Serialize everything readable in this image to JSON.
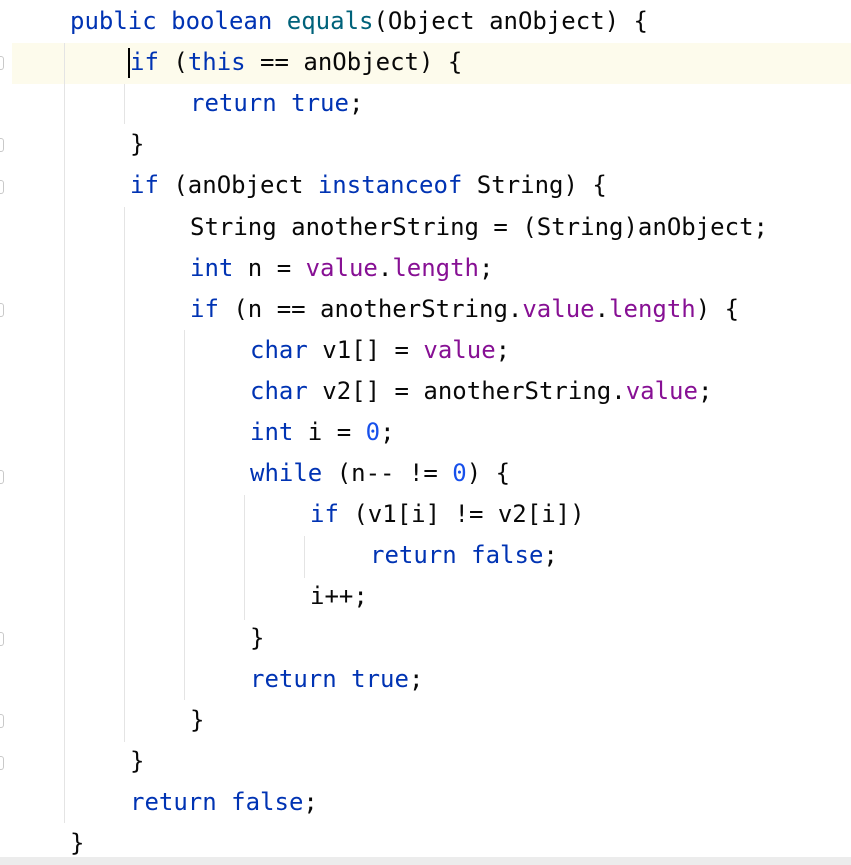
{
  "editor": {
    "language": "Java",
    "colors": {
      "keyword": "#0033b3",
      "method": "#00627a",
      "field": "#871094",
      "number": "#1750eb",
      "text": "#080808",
      "caret_line_bg": "#fdfbec"
    },
    "lines": [
      [
        {
          "t": "public",
          "c": "kw"
        },
        {
          "t": " "
        },
        {
          "t": "boolean",
          "c": "kw"
        },
        {
          "t": " "
        },
        {
          "t": "equals",
          "c": "fn"
        },
        {
          "t": "(Object anObject) {"
        }
      ],
      [
        {
          "t": "if",
          "c": "kw"
        },
        {
          "t": " ("
        },
        {
          "t": "this",
          "c": "kw"
        },
        {
          "t": " == anObject) {"
        }
      ],
      [
        {
          "t": "return",
          "c": "kw"
        },
        {
          "t": " "
        },
        {
          "t": "true",
          "c": "kw"
        },
        {
          "t": ";"
        }
      ],
      [
        {
          "t": "}"
        }
      ],
      [
        {
          "t": "if",
          "c": "kw"
        },
        {
          "t": " (anObject "
        },
        {
          "t": "instanceof",
          "c": "kw"
        },
        {
          "t": " String) {"
        }
      ],
      [
        {
          "t": "String anotherString = (String)anObject;"
        }
      ],
      [
        {
          "t": "int",
          "c": "kw"
        },
        {
          "t": " n = "
        },
        {
          "t": "value",
          "c": "fld"
        },
        {
          "t": "."
        },
        {
          "t": "length",
          "c": "fld"
        },
        {
          "t": ";"
        }
      ],
      [
        {
          "t": "if",
          "c": "kw"
        },
        {
          "t": " (n == anotherString."
        },
        {
          "t": "value",
          "c": "fld"
        },
        {
          "t": "."
        },
        {
          "t": "length",
          "c": "fld"
        },
        {
          "t": ") {"
        }
      ],
      [
        {
          "t": "char",
          "c": "kw"
        },
        {
          "t": " v1[] = "
        },
        {
          "t": "value",
          "c": "fld"
        },
        {
          "t": ";"
        }
      ],
      [
        {
          "t": "char",
          "c": "kw"
        },
        {
          "t": " v2[] = anotherString."
        },
        {
          "t": "value",
          "c": "fld"
        },
        {
          "t": ";"
        }
      ],
      [
        {
          "t": "int",
          "c": "kw"
        },
        {
          "t": " i = "
        },
        {
          "t": "0",
          "c": "num"
        },
        {
          "t": ";"
        }
      ],
      [
        {
          "t": "while",
          "c": "kw"
        },
        {
          "t": " (n-- != "
        },
        {
          "t": "0",
          "c": "num"
        },
        {
          "t": ") {"
        }
      ],
      [
        {
          "t": "if",
          "c": "kw"
        },
        {
          "t": " (v1[i] != v2[i])"
        }
      ],
      [
        {
          "t": "return",
          "c": "kw"
        },
        {
          "t": " "
        },
        {
          "t": "false",
          "c": "kw"
        },
        {
          "t": ";"
        }
      ],
      [
        {
          "t": "i++;"
        }
      ],
      [
        {
          "t": "}"
        }
      ],
      [
        {
          "t": "return",
          "c": "kw"
        },
        {
          "t": " "
        },
        {
          "t": "true",
          "c": "kw"
        },
        {
          "t": ";"
        }
      ],
      [
        {
          "t": "}"
        }
      ],
      [
        {
          "t": "}"
        }
      ],
      [
        {
          "t": "return",
          "c": "kw"
        },
        {
          "t": " "
        },
        {
          "t": "false",
          "c": "kw"
        },
        {
          "t": ";"
        }
      ],
      [
        {
          "t": "}"
        }
      ]
    ]
  }
}
